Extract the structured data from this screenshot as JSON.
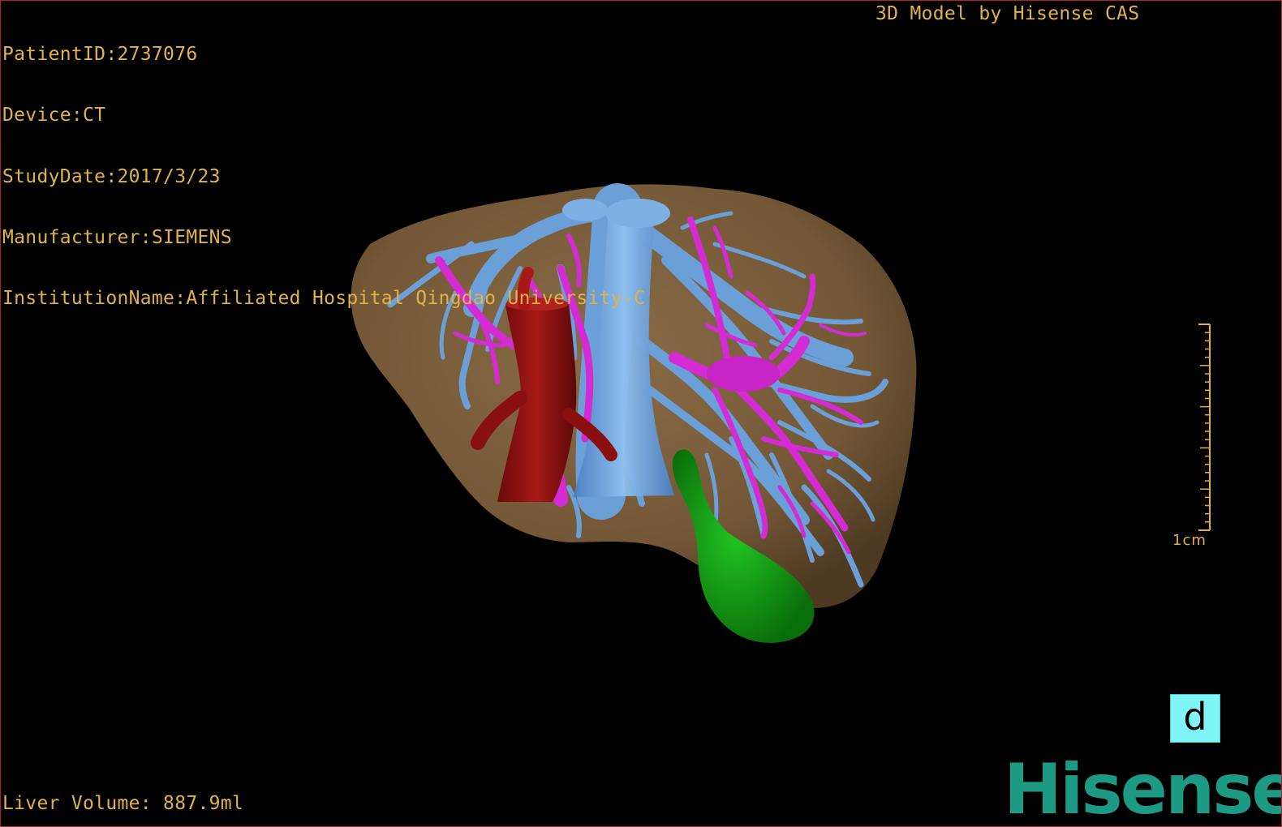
{
  "header": {
    "patient_id": "PatientID:2737076",
    "device": "Device:CT",
    "study_date": "StudyDate:2017/3/23",
    "manufacturer": "Manufacturer:SIEMENS",
    "institution": "InstitutionName:Affiliated Hospital Qingdao University-C",
    "credit": "3D Model by Hisense CAS"
  },
  "footer": {
    "liver_volume": "Liver Volume: 887.9ml"
  },
  "scale": {
    "label": "1cm"
  },
  "orientation": {
    "label": "d"
  },
  "brand": {
    "name": "Hisense",
    "color": "#1d9a84"
  },
  "colors": {
    "overlay_text": "#e0b24a",
    "liver": "#7a5e3c",
    "hepatic_vein": "#6b9fd8",
    "portal_vein": "#d42bd4",
    "ivc": "#9a1414",
    "gallbladder": "#12a012",
    "orientation_cube": "#7ff5f8",
    "border": "#b0222a"
  },
  "model": {
    "structures": [
      "liver",
      "hepatic-vein",
      "portal-vein",
      "inferior-vena-cava",
      "gallbladder"
    ]
  }
}
